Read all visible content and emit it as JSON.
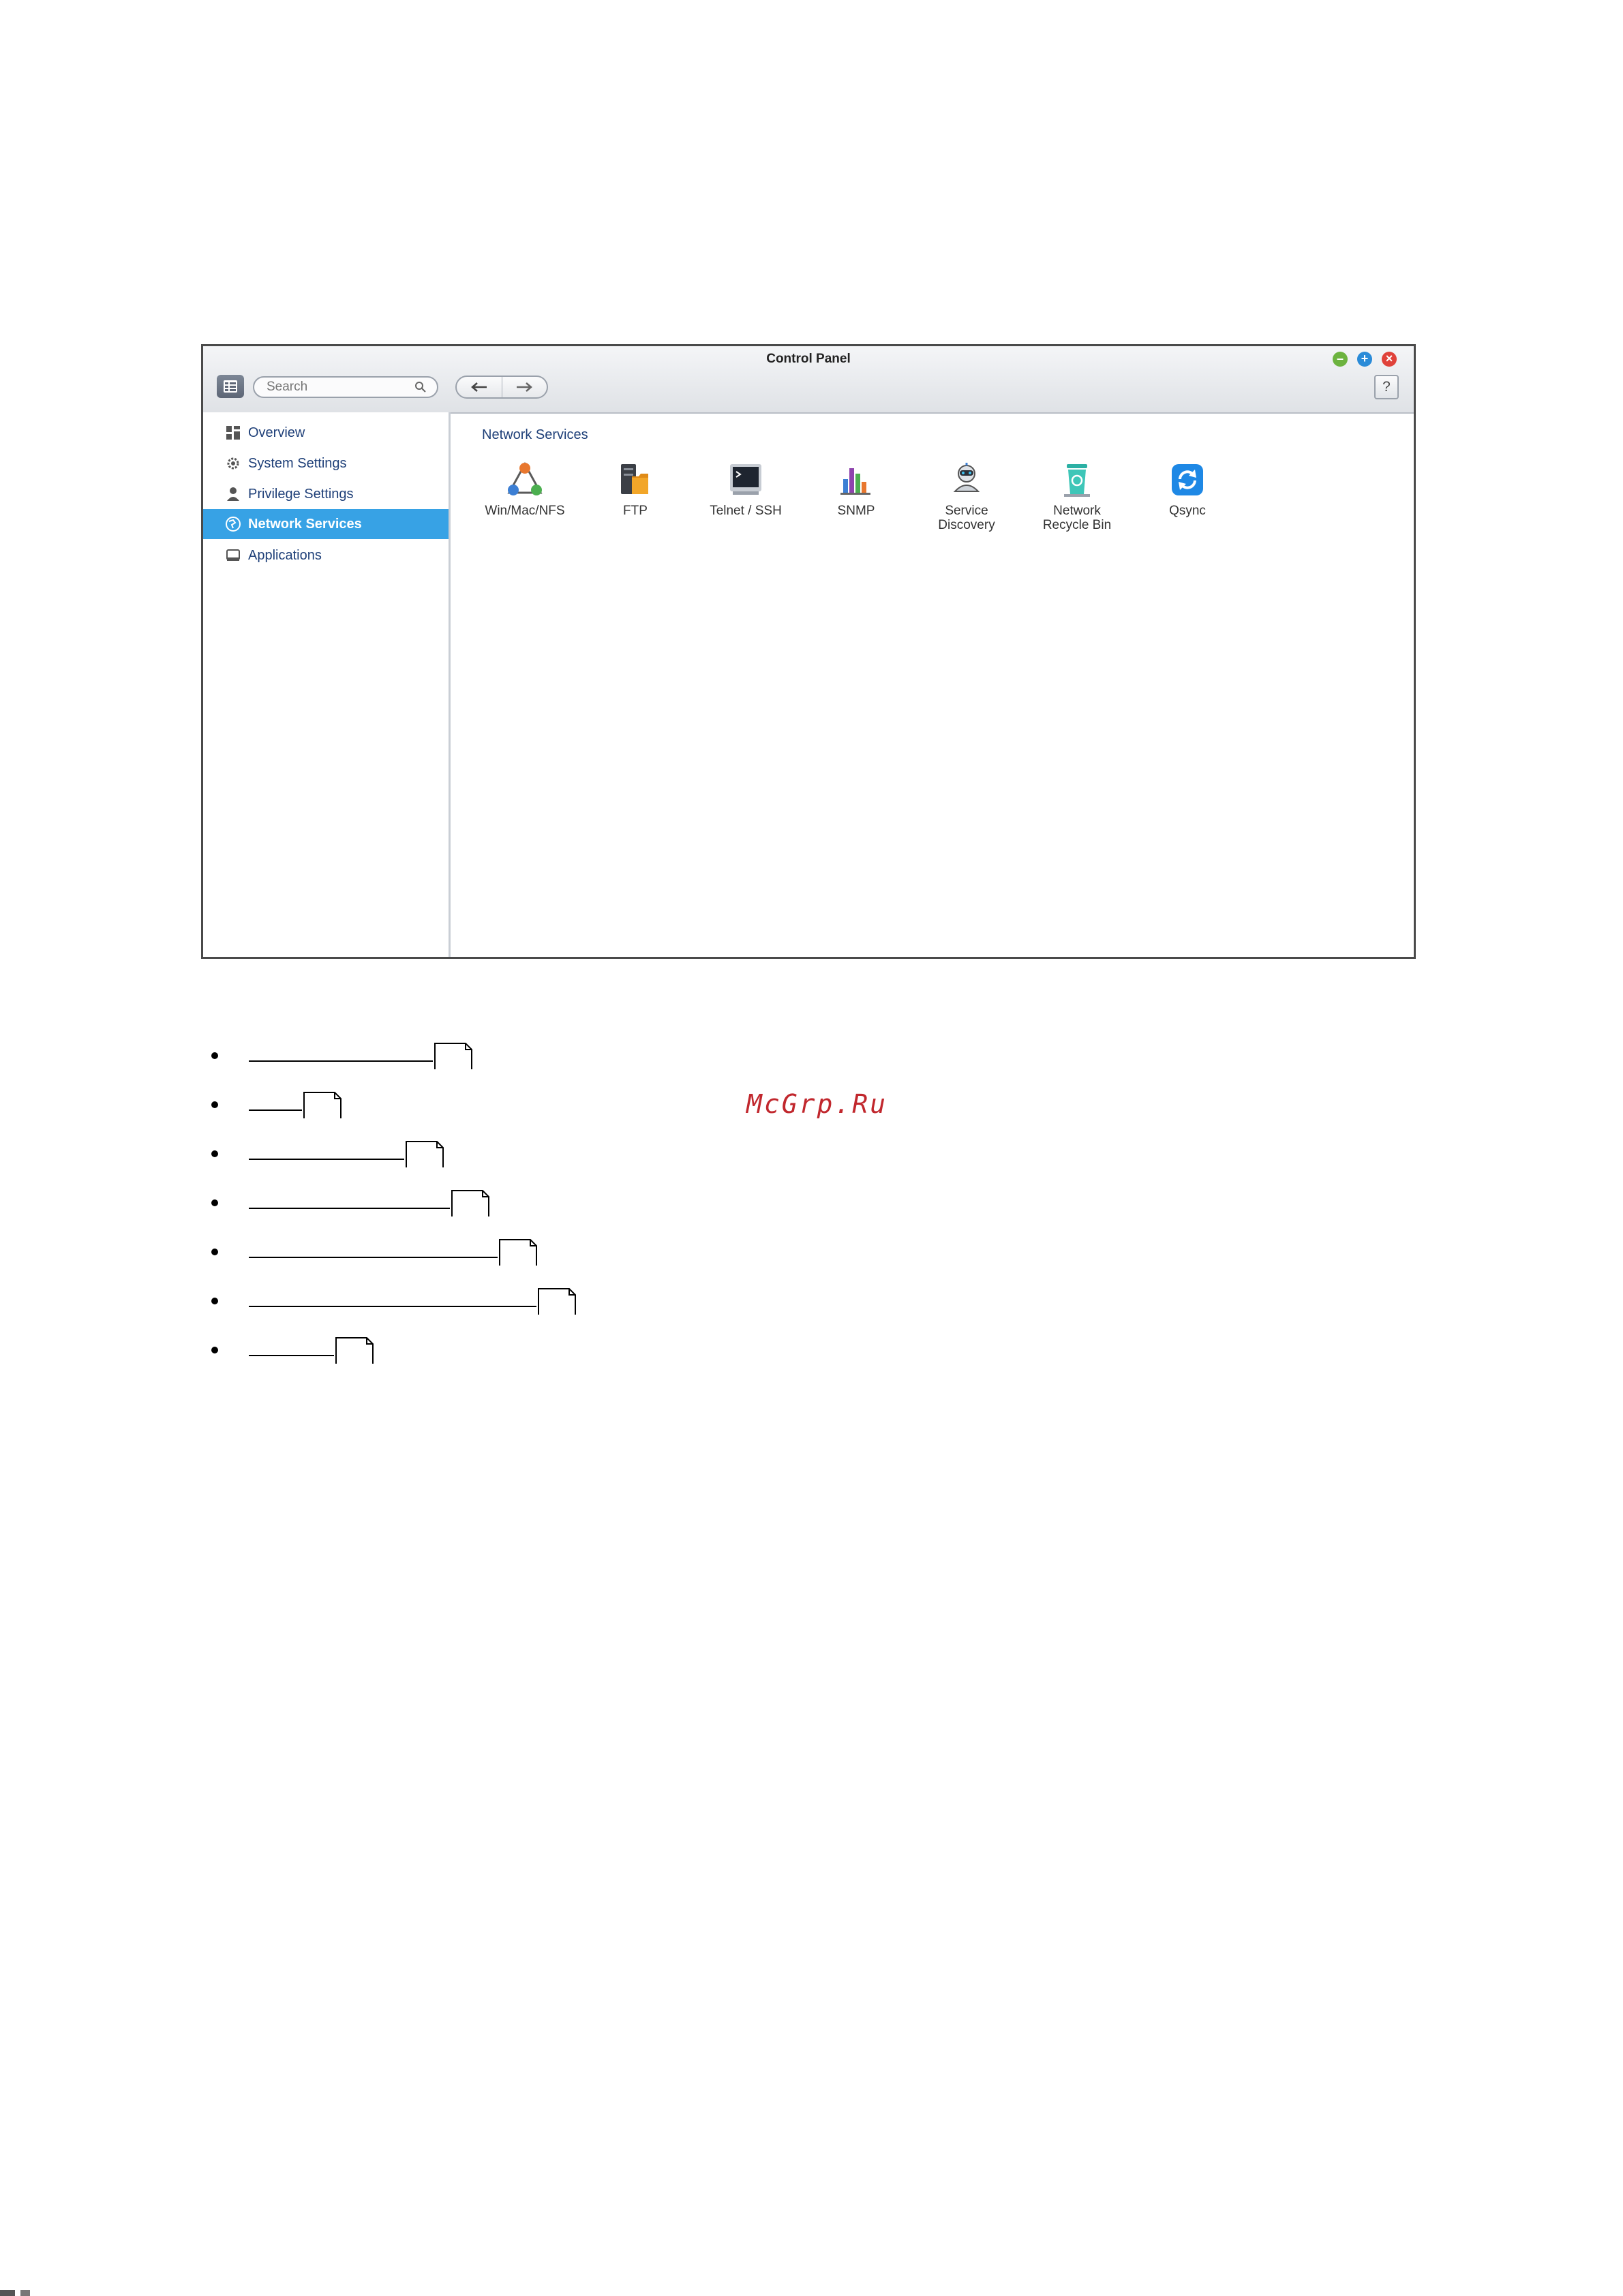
{
  "window": {
    "title": "Control Panel",
    "minimize_icon": "minimize-icon",
    "maximize_icon": "maximize-icon",
    "close_icon": "close-icon"
  },
  "toolbar": {
    "search_placeholder": "Search",
    "help_label": "?"
  },
  "sidebar": {
    "items": [
      {
        "label": "Overview",
        "icon": "overview-icon"
      },
      {
        "label": "System Settings",
        "icon": "gear-icon"
      },
      {
        "label": "Privilege Settings",
        "icon": "user-icon"
      },
      {
        "label": "Network Services",
        "icon": "network-globe-icon",
        "active": true
      },
      {
        "label": "Applications",
        "icon": "applications-icon"
      }
    ]
  },
  "main": {
    "section_title": "Network Services",
    "tiles": [
      {
        "label": "Win/Mac/NFS",
        "icon": "win-mac-nfs-icon"
      },
      {
        "label": "FTP",
        "icon": "ftp-icon"
      },
      {
        "label": "Telnet / SSH",
        "icon": "terminal-icon"
      },
      {
        "label": "SNMP",
        "icon": "chart-bars-icon"
      },
      {
        "label": "Service\nDiscovery",
        "icon": "robot-icon"
      },
      {
        "label": "Network\nRecycle Bin",
        "icon": "recycle-bin-icon"
      },
      {
        "label": "Qsync",
        "icon": "sync-icon"
      }
    ]
  },
  "watermark": "McGrp.Ru",
  "colors": {
    "accent": "#37a2e5",
    "link_text": "#1e3f78",
    "watermark": "#c1272d"
  }
}
